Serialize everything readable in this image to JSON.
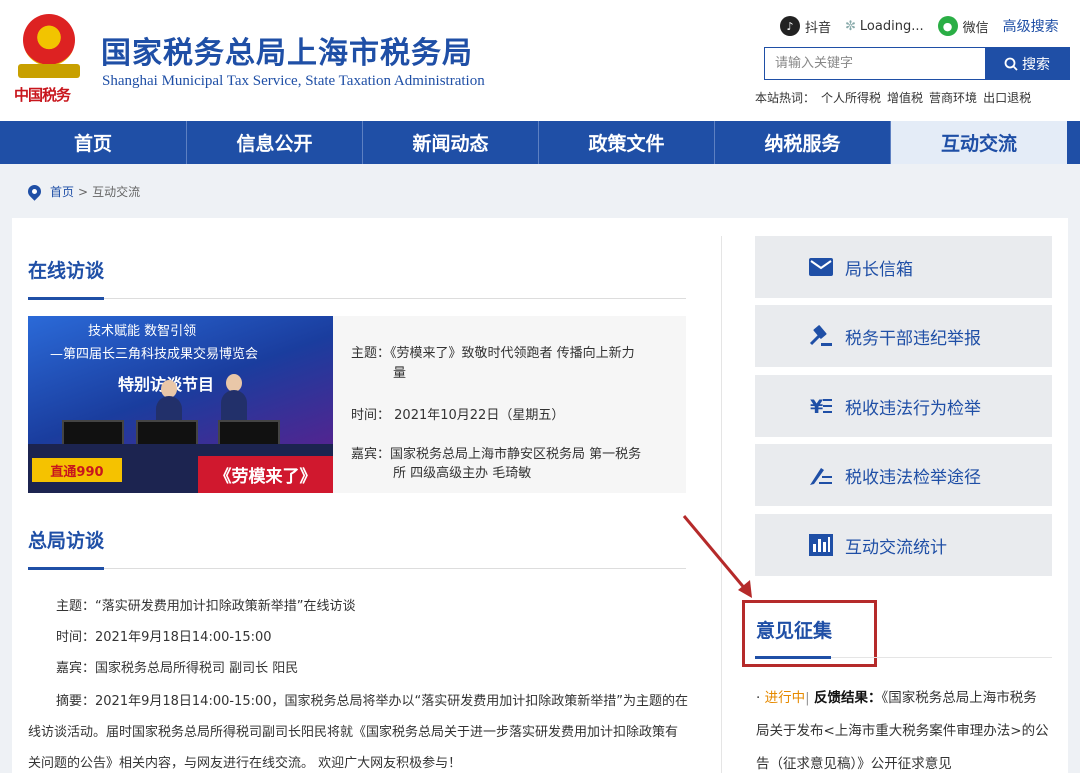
{
  "header": {
    "title": "国家税务总局上海市税务局",
    "subtitle": "Shanghai Municipal Tax Service, State Taxation Administration",
    "emblem_text": "中国税务",
    "links": {
      "douyin": "抖音",
      "loading": "Loading...",
      "wechat": "微信",
      "advanced_search": "高级搜索"
    },
    "search": {
      "placeholder": "请输入关键字",
      "button": "搜索"
    },
    "hot": {
      "label": "本站热词：",
      "words": [
        "个人所得税",
        "增值税",
        "营商环境",
        "出口退税"
      ]
    }
  },
  "nav": {
    "items": [
      "首页",
      "信息公开",
      "新闻动态",
      "政策文件",
      "纳税服务",
      "互动交流"
    ],
    "active": "互动交流"
  },
  "breadcrumb": {
    "home": "首页",
    "separator": ">",
    "current": "互动交流"
  },
  "online_interview": {
    "title": "在线访谈",
    "photo": {
      "line1": "技术赋能 数智引领",
      "line2": "—第四届长三角科技成果交易博览会",
      "line3": "特别访谈节目",
      "badge": "直通990",
      "banner": "《劳模来了》"
    },
    "subject_label": "主题：",
    "subject_line1": "《劳模来了》致敬时代领跑者 传播向上新力",
    "subject_line2": "量",
    "time_label": "时间：",
    "time": "2021年10月22日（星期五）",
    "guest_label": "嘉宾：",
    "guest_line1": "国家税务总局上海市静安区税务局 第一税务",
    "guest_line2": "所 四级高级主办 毛琦敏"
  },
  "hq_interview": {
    "title": "总局访谈",
    "subject": "主题：“落实研发费用加计扣除政策新举措”在线访谈",
    "time": "时间：2021年9月18日14:00-15:00",
    "guest": "嘉宾：国家税务总局所得税司 副司长 阳民",
    "summary": "摘要：2021年9月18日14:00-15:00，国家税务总局将举办以“落实研发费用加计扣除政策新举措”为主题的在线访谈活动。届时国家税务总局所得税司副司长阳民将就《国家税务总局关于进一步落实研发费用加计扣除政策有关问题的公告》相关内容，与网友进行在线交流。 欢迎广大网友积极参与！"
  },
  "sidebar": {
    "buttons": [
      "局长信箱",
      "税务干部违纪举报",
      "税收违法行为检举",
      "税收违法检举途径",
      "互动交流统计"
    ]
  },
  "opinion": {
    "title": "意见征集",
    "status": "进行中",
    "divider": "|",
    "label": "反馈结果：",
    "text": "《国家税务总局上海市税务局关于发布<上海市重大税务案件审理办法>的公告（征求意见稿）》公开征求意见"
  },
  "colors": {
    "brand_blue": "#1f4fa6",
    "nav_active_bg": "#e4ecf7",
    "annotation_red": "#b52a2a",
    "status_orange": "#e68a00"
  }
}
